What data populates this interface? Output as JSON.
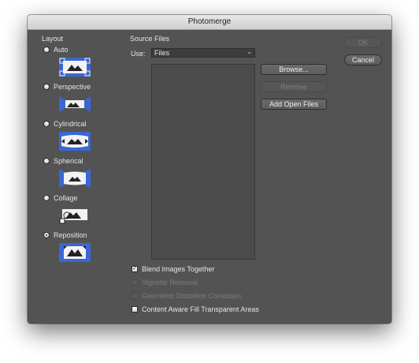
{
  "dialog": {
    "title": "Photomerge"
  },
  "layout": {
    "heading": "Layout",
    "options": [
      {
        "label": "Auto",
        "checked": false
      },
      {
        "label": "Perspective",
        "checked": false
      },
      {
        "label": "Cylindrical",
        "checked": false
      },
      {
        "label": "Spherical",
        "checked": false
      },
      {
        "label": "Collage",
        "checked": false
      },
      {
        "label": "Reposition",
        "checked": true
      }
    ]
  },
  "source": {
    "heading": "Source Files",
    "use_label": "Use:",
    "use_value": "Files",
    "browse_label": "Browse...",
    "remove_label": "Remove",
    "add_open_label": "Add Open Files"
  },
  "options": {
    "blend": {
      "label": "Blend Images Together",
      "checked": true,
      "enabled": true
    },
    "vignette": {
      "label": "Vignette Removal",
      "checked": false,
      "enabled": false
    },
    "distortion": {
      "label": "Geometric Distortion Correction",
      "checked": false,
      "enabled": false
    },
    "content_aware": {
      "label": "Content Aware Fill Transparent Areas",
      "checked": false,
      "enabled": true
    }
  },
  "actions": {
    "ok_label": "OK",
    "cancel_label": "Cancel"
  },
  "colors": {
    "accent_blue": "#3a66d6",
    "dialog_bg": "#535353"
  }
}
